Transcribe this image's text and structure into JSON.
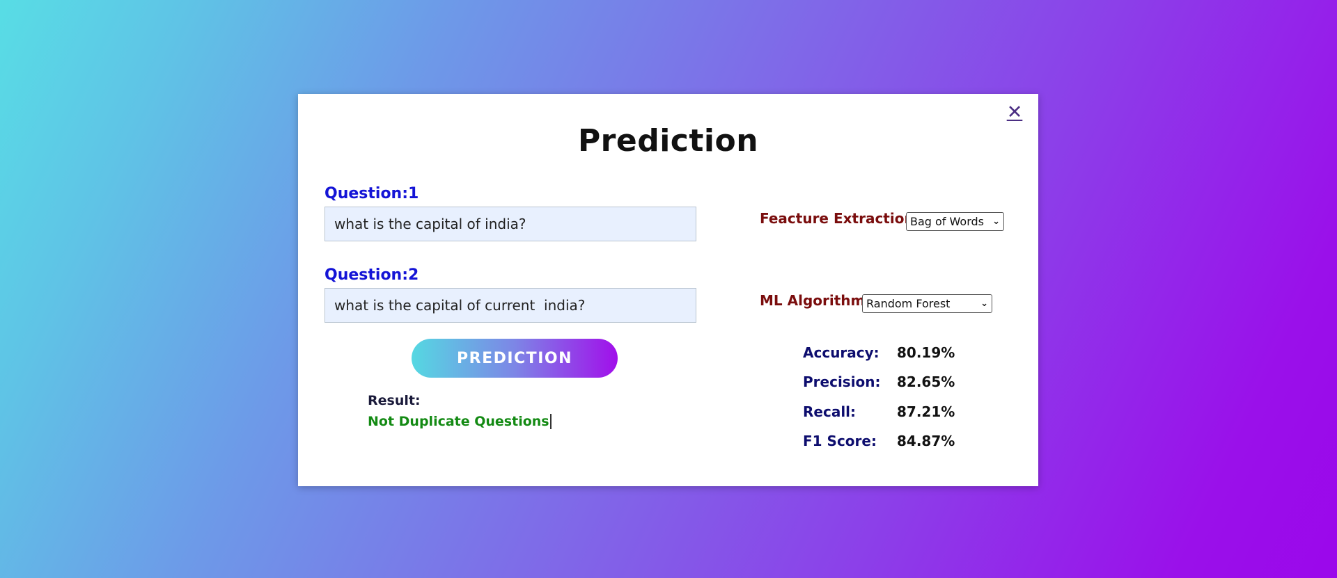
{
  "modal": {
    "close_glyph": "✕",
    "title": "Prediction"
  },
  "question1": {
    "label": "Question:1",
    "value": "what is the capital of india?"
  },
  "question2": {
    "label": "Question:2",
    "value": "what is the capital of current  india?"
  },
  "predict_button": {
    "label": "PREDICTION"
  },
  "result": {
    "label": "Result:",
    "value": "Not Duplicate Questions"
  },
  "feature_extraction": {
    "label": "Feacture Extraction:",
    "selected": "Bag of Words"
  },
  "ml_algorithm": {
    "label": "ML Algorithm:",
    "selected": "Random Forest"
  },
  "metrics": [
    {
      "label": "Accuracy:",
      "value": "80.19%"
    },
    {
      "label": "Precision:",
      "value": "82.65%"
    },
    {
      "label": "Recall:",
      "value": "87.21%"
    },
    {
      "label": "F1 Score:",
      "value": "84.87%"
    }
  ],
  "colors": {
    "question_label": "#1414d6",
    "option_label": "#7a0d0d",
    "metric_label": "#0d0d6e",
    "result_value": "#138a13"
  }
}
